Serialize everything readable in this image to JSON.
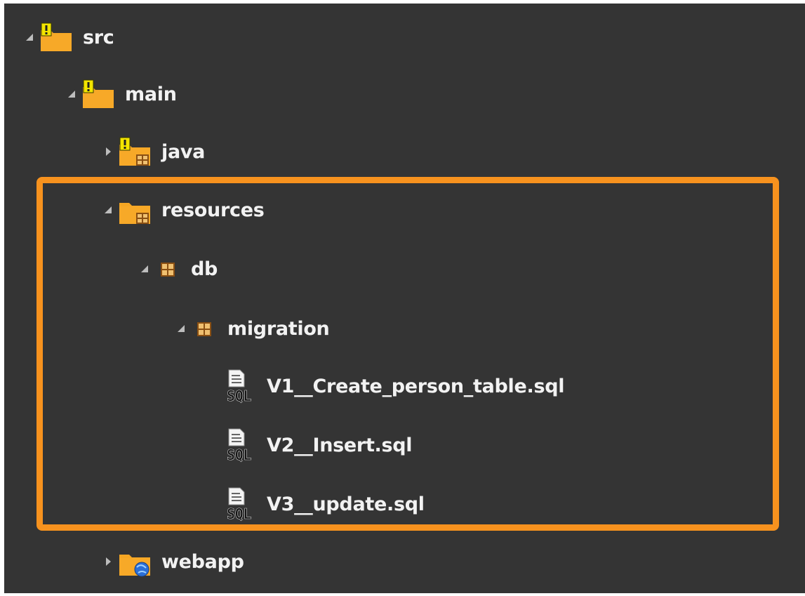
{
  "tree": {
    "src": {
      "label": "src",
      "state": "expanded",
      "icon": "folder-warning-icon"
    },
    "main": {
      "label": "main",
      "state": "expanded",
      "icon": "folder-warning-icon"
    },
    "java": {
      "label": "java",
      "state": "collapsed",
      "icon": "source-folder-warning-icon"
    },
    "resources": {
      "label": "resources",
      "state": "expanded",
      "icon": "source-folder-icon"
    },
    "db": {
      "label": "db",
      "state": "expanded",
      "icon": "package-icon"
    },
    "migration": {
      "label": "migration",
      "state": "expanded",
      "icon": "package-icon"
    },
    "files": [
      {
        "label": "V1__Create_person_table.sql",
        "icon": "sql-file-icon"
      },
      {
        "label": "V2__Insert.sql",
        "icon": "sql-file-icon"
      },
      {
        "label": "V3__update.sql",
        "icon": "sql-file-icon"
      }
    ],
    "webapp": {
      "label": "webapp",
      "state": "collapsed",
      "icon": "web-folder-icon"
    }
  },
  "colors": {
    "background": "#343434",
    "text": "#f2f2f2",
    "highlight": "#f7921e",
    "folder": "#f5a623",
    "warning": "#f3e500",
    "package": "#c98a3e",
    "globe": "#2b6fd6"
  }
}
